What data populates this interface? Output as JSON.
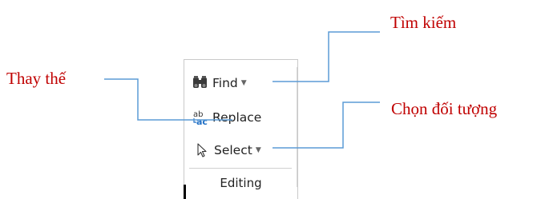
{
  "ribbon": {
    "group_label": "Editing",
    "buttons": [
      {
        "label": "Find",
        "icon": "binoculars-icon",
        "has_dropdown": true
      },
      {
        "label": "Replace",
        "icon": "replace-ab-ac-icon",
        "has_dropdown": false
      },
      {
        "label": "Select",
        "icon": "cursor-arrow-icon",
        "has_dropdown": true
      }
    ]
  },
  "callouts": {
    "find": "Tìm kiếm",
    "replace": "Thay thế",
    "select": "Chọn đối tượng"
  },
  "colors": {
    "callout_text": "#c00000",
    "leader_line": "#5b9bd5",
    "icon_blue": "#1f6fc5"
  }
}
